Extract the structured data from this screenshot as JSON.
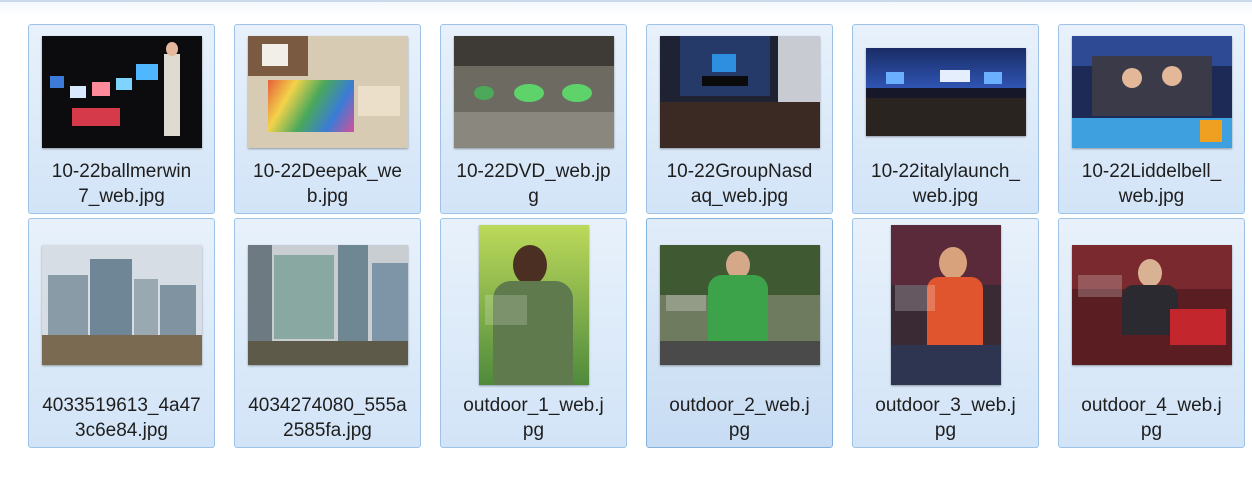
{
  "files": [
    {
      "name": "10-22ballmerwin7_web.jpg",
      "line1": "10-22ballmerwin",
      "line2": "7_web.jpg"
    },
    {
      "name": "10-22Deepak_web.jpg",
      "line1": "10-22Deepak_we",
      "line2": "b.jpg"
    },
    {
      "name": "10-22DVD_web.jpg",
      "line1": "10-22DVD_web.jp",
      "line2": "g"
    },
    {
      "name": "10-22GroupNasdaq_web.jpg",
      "line1": "10-22GroupNasd",
      "line2": "aq_web.jpg"
    },
    {
      "name": "10-22italylaunch_web.jpg",
      "line1": "10-22italylaunch_",
      "line2": "web.jpg"
    },
    {
      "name": "10-22Liddelbell_web.jpg",
      "line1": "10-22Liddelbell_",
      "line2": "web.jpg"
    },
    {
      "name": "4033519613_4a473c6e84.jpg",
      "line1": "4033519613_4a47",
      "line2": "3c6e84.jpg"
    },
    {
      "name": "4034274080_555a2585fa.jpg",
      "line1": "4034274080_555a",
      "line2": "2585fa.jpg"
    },
    {
      "name": "outdoor_1_web.jpg",
      "line1": "outdoor_1_web.j",
      "line2": "pg"
    },
    {
      "name": "outdoor_2_web.jpg",
      "line1": "outdoor_2_web.j",
      "line2": "pg"
    },
    {
      "name": "outdoor_3_web.jpg",
      "line1": "outdoor_3_web.j",
      "line2": "pg"
    },
    {
      "name": "outdoor_4_web.jpg",
      "line1": "outdoor_4_web.j",
      "line2": "pg"
    }
  ],
  "colors": {
    "tile_bg": "#d2e4f7",
    "tile_border": "#9ec3e6"
  }
}
